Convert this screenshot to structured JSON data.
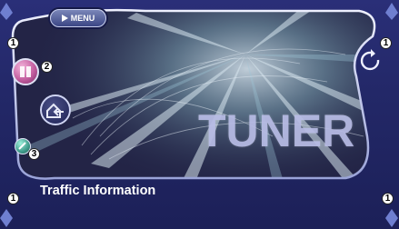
{
  "header": {
    "menu_label": "MENU",
    "menu_icon": "play-triangle-icon"
  },
  "main": {
    "source_title": "TUNER",
    "info_text": "Traffic Information"
  },
  "callouts": {
    "top_left": "1",
    "top_right": "1",
    "bottom_left": "1",
    "bottom_right": "1",
    "source_button": "2",
    "scroll_button": "3"
  },
  "buttons": {
    "source_icon": "pause-split-icon",
    "return_icon": "home-return-icon",
    "scroll_icon": "scroll-text-icon",
    "rotate_icon": "rotate-arrow-icon"
  },
  "colors": {
    "panel": "#1c2058",
    "source_button": "#c45fa0",
    "scroll_button": "#3f9a8a",
    "accent_text": "#b9bde6"
  }
}
